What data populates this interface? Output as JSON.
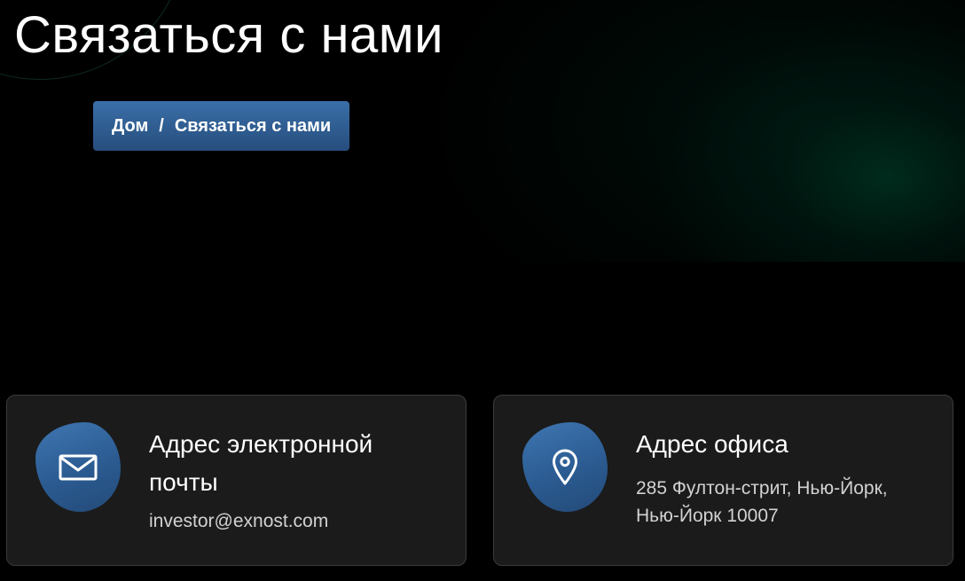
{
  "page": {
    "title": "Связаться с нами"
  },
  "breadcrumb": {
    "home": "Дом",
    "separator": "/",
    "current": "Связаться с нами"
  },
  "contacts": {
    "email": {
      "icon": "envelope-icon",
      "title": "Адрес электронной почты",
      "value": "investor@exnost.com"
    },
    "office": {
      "icon": "map-pin-icon",
      "title": "Адрес офиса",
      "value": "285 Фултон-стрит, Нью-Йорк, Нью-Йорк 10007"
    }
  },
  "colors": {
    "background": "#000000",
    "accent": "#3a6fa8",
    "card_background": "#1b1b1b",
    "hero_glow": "#00462d"
  }
}
